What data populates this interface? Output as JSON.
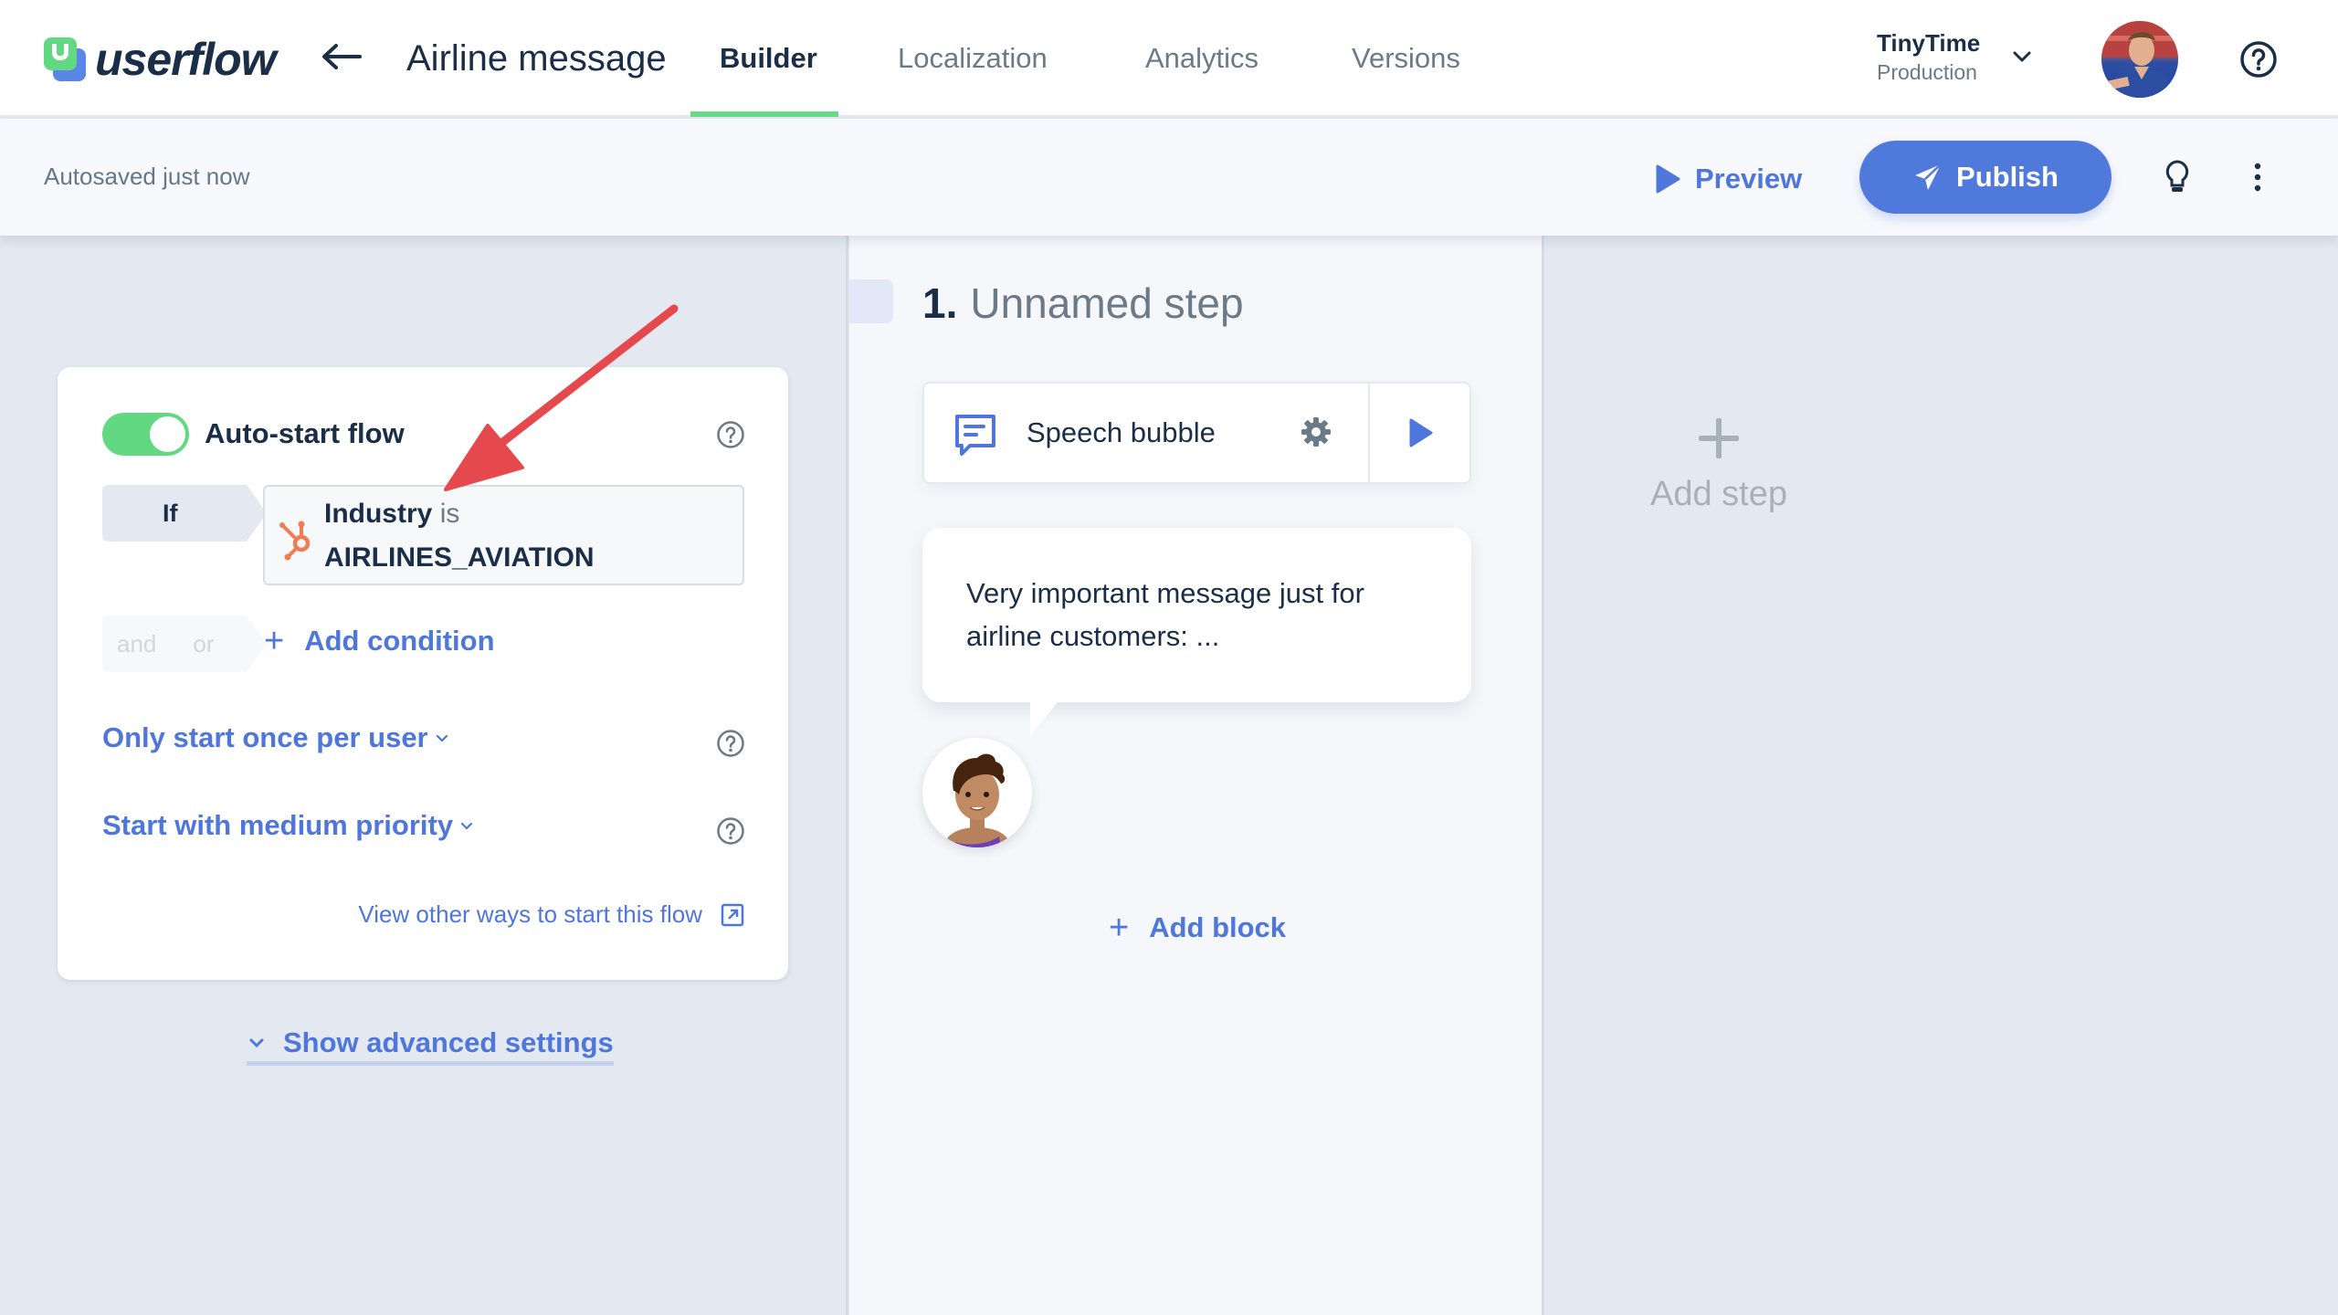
{
  "header": {
    "logo_text": "userflow",
    "back_icon": "arrow-left-icon",
    "flow_title": "Airline message",
    "tabs": [
      {
        "label": "Builder",
        "active": true
      },
      {
        "label": "Localization",
        "active": false
      },
      {
        "label": "Analytics",
        "active": false
      },
      {
        "label": "Versions",
        "active": false
      }
    ],
    "workspace": {
      "name": "TinyTime",
      "environment": "Production"
    },
    "help_icon": "question-circle-icon"
  },
  "toolbar": {
    "autosave_status": "Autosaved just now",
    "preview_label": "Preview",
    "publish_label": "Publish",
    "tips_icon": "lightbulb-icon",
    "more_icon": "kebab-menu-icon"
  },
  "start_settings": {
    "auto_start": {
      "label": "Auto-start flow",
      "enabled": true
    },
    "if_label": "If",
    "condition": {
      "attribute": "Industry",
      "operator": "is",
      "value": "AIRLINES_AVIATION",
      "source_icon": "hubspot-icon"
    },
    "and_label": "and",
    "or_label": "or",
    "add_condition_label": "Add condition",
    "frequency_label": "Only start once per user",
    "priority_label": "Start with medium priority",
    "view_other_label": "View other ways to start this flow",
    "advanced_label": "Show advanced settings"
  },
  "step": {
    "number": "1.",
    "name": "Unnamed step",
    "block": {
      "label": "Speech bubble"
    },
    "bubble_text": "Very important message just for airline customers: ...",
    "add_block_label": "Add block"
  },
  "add_step_label": "Add step",
  "colors": {
    "accent": "#5079dc",
    "brand_green": "#63d883",
    "annotation_red": "#e5484d",
    "hubspot_orange": "#f07c54"
  }
}
